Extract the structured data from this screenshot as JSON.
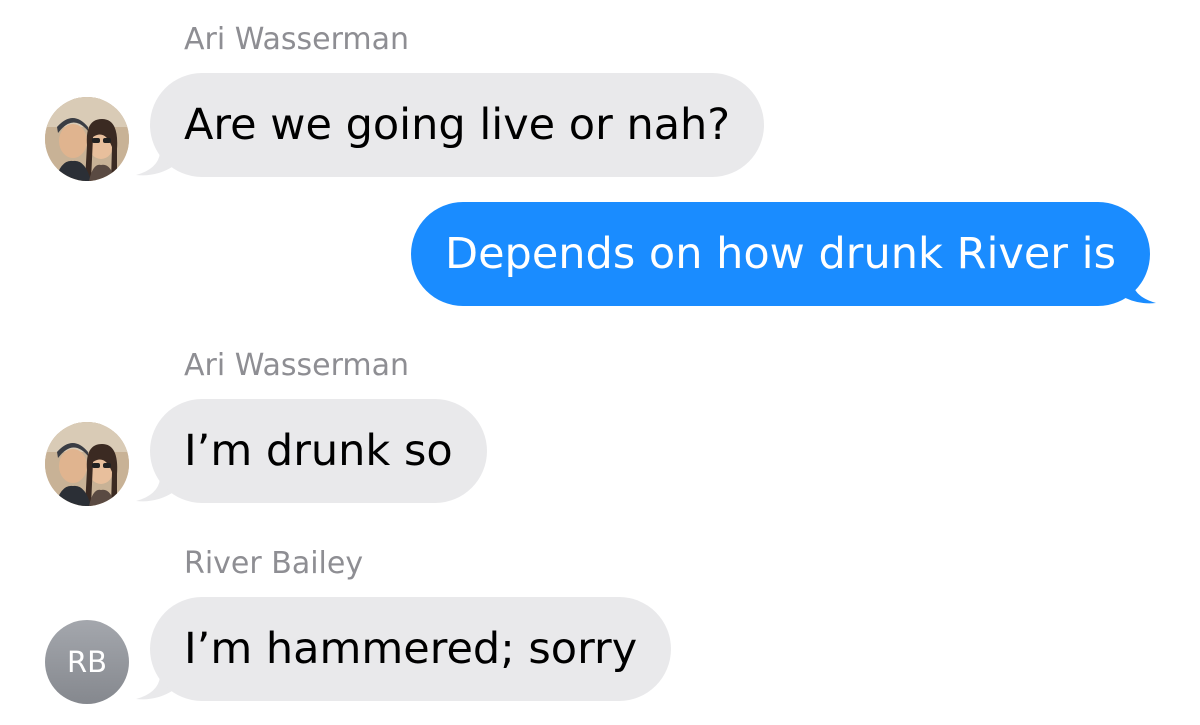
{
  "colors": {
    "incoming_bubble": "#e9e9eb",
    "outgoing_bubble": "#1a8cff",
    "sender_label": "#8e8e93",
    "initials_avatar": "#939599"
  },
  "messages": [
    {
      "direction": "incoming",
      "sender": "Ari Wasserman",
      "avatar": "photo",
      "text": "Are we going live or nah?"
    },
    {
      "direction": "outgoing",
      "text": "Depends on how drunk River is"
    },
    {
      "direction": "incoming",
      "sender": "Ari Wasserman",
      "avatar": "photo",
      "text": "I’m drunk so"
    },
    {
      "direction": "incoming",
      "sender": "River Bailey",
      "avatar_initials": "RB",
      "text": "I’m hammered; sorry"
    }
  ]
}
